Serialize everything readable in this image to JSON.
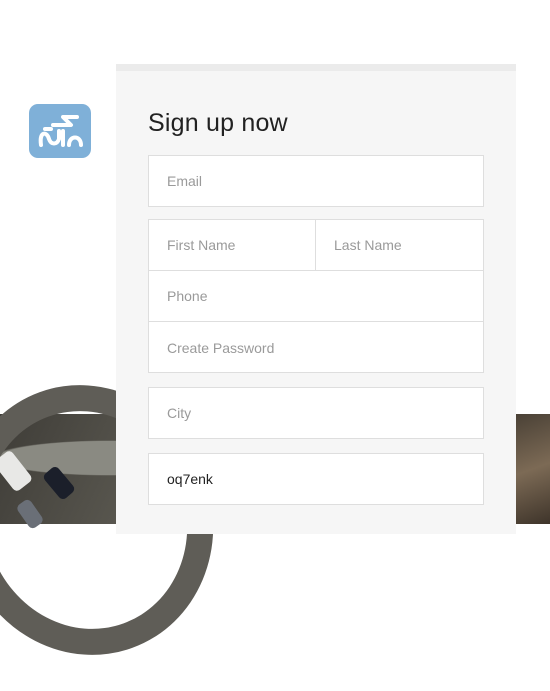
{
  "form": {
    "title": "Sign up now",
    "email_placeholder": "Email",
    "first_name_placeholder": "First Name",
    "last_name_placeholder": "Last Name",
    "phone_placeholder": "Phone",
    "password_placeholder": "Create Password",
    "city_placeholder": "City",
    "code_value": "oq7enk"
  },
  "logo": {
    "icon": "arabic-calligraphy-logo",
    "color": "#7fb0d8"
  },
  "colors": {
    "panel_bg": "#f6f6f6",
    "field_border": "#dedede",
    "placeholder": "#9a9a9a"
  }
}
